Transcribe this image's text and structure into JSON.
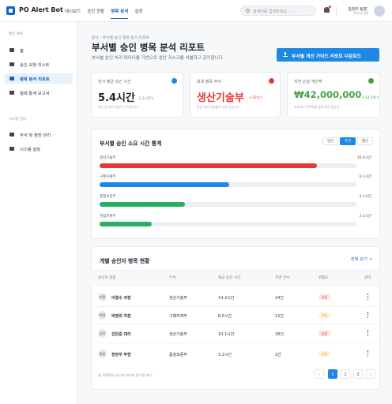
{
  "header": {
    "brand": "PO Alert Bot",
    "nav": [
      "대시보드",
      "승인 현황",
      "병목 분석",
      "설정"
    ],
    "search_placeholder": "검색어를 입력하세요...",
    "user_name": "김관리 팀장",
    "user_role": "관리자 권한"
  },
  "sidebar": {
    "sec1": "메인 메뉴",
    "items": [
      "홈",
      "승인 요청 리스트",
      "병목 분석 리포트",
      "월례 통계 보고서"
    ],
    "sec2": "시스템 관리",
    "items2": [
      "부서 및 권한 관리",
      "시스템 설정"
    ]
  },
  "page": {
    "breadcrumb": "분석  ›  부서별 승인 병목 분석 리포트",
    "title": "부서별 승인 병목 분석 리포트",
    "subtitle": "부서별 승인 처리 데이터를 기반으로 생산 리스크를 식별하고 관리합니다.",
    "download": "부서별 개선 가이드 리포트 다운로드"
  },
  "kpis": [
    {
      "label": "전사 평균 승인 시간",
      "value": "5.4시간",
      "delta": "-1.2시간↓",
      "foot": "지난 달 대비 개선된 수치입니다",
      "icon": "clock-icon",
      "color": "#1e88e5",
      "delta_color": "#43a047",
      "value_color": "#1b2430"
    },
    {
      "label": "최대 병목 부서",
      "value": "생산기술부",
      "delta": "+15%↑",
      "foot": "평균 대비 지연율이 가장 높습니다",
      "icon": "alert-icon",
      "color": "#e53935",
      "delta_color": "#e53935",
      "value_color": "#e53935"
    },
    {
      "label": "지연 손실 개선액",
      "value": "₩42,000,000",
      "delta": "+12.5%↑",
      "foot": "프로세스 최적화를 통한 예상 절감액",
      "icon": "money-icon",
      "color": "#43a047",
      "delta_color": "#43a047",
      "value_color": "#43a047"
    }
  ],
  "stats": {
    "title": "부서별 승인 소요 시간 통계",
    "toggles": [
      "일간",
      "주간",
      "월간"
    ],
    "active": 1
  },
  "chart_data": {
    "type": "bar",
    "categories": [
      "생산기술부",
      "구매자재부",
      "품질보증부",
      "영업지원부"
    ],
    "values": [
      10.4,
      6.2,
      4.1,
      2.5
    ],
    "unit": "시간",
    "colors": [
      "#e53935",
      "#1e88e5",
      "#27ae60",
      "#27ae60"
    ],
    "xlim": [
      0,
      12.3
    ]
  },
  "approvers": {
    "title": "개별 승인자 병목 현황",
    "viewall": "전체 보기 ↗",
    "headers": [
      "승인자 성함",
      "부서",
      "평균 승인 시간",
      "지연 건수",
      "위험도",
      "관리"
    ],
    "rows": [
      {
        "initial": "이철",
        "name": "이철수 과장",
        "dept": "생산기술부",
        "time": "14.2시간",
        "delays": "24건",
        "risk": "높음",
        "risk_bg": "#fde3e3",
        "risk_fg": "#e53935"
      },
      {
        "initial": "박영",
        "name": "박영희 차장",
        "dept": "구매자재부",
        "time": "8.5시간",
        "delays": "12건",
        "risk": "보통",
        "risk_bg": "#fff0d9",
        "risk_fg": "#f39c12"
      },
      {
        "initial": "김민",
        "name": "김민준 대리",
        "dept": "생산기술부",
        "time": "10.1시간",
        "delays": "18건",
        "risk": "높음",
        "risk_bg": "#fde3e3",
        "risk_fg": "#e53935"
      },
      {
        "initial": "정현",
        "name": "정현우 부장",
        "dept": "품질보증부",
        "time": "3.2시간",
        "delays": "2건",
        "risk": "낮음",
        "risk_bg": "#fff0d9",
        "risk_fg": "#f39c12"
      }
    ],
    "footer": "총 128명의 승인자 데이터 중 4명 표시",
    "pages": [
      "1",
      "2",
      "3"
    ]
  }
}
